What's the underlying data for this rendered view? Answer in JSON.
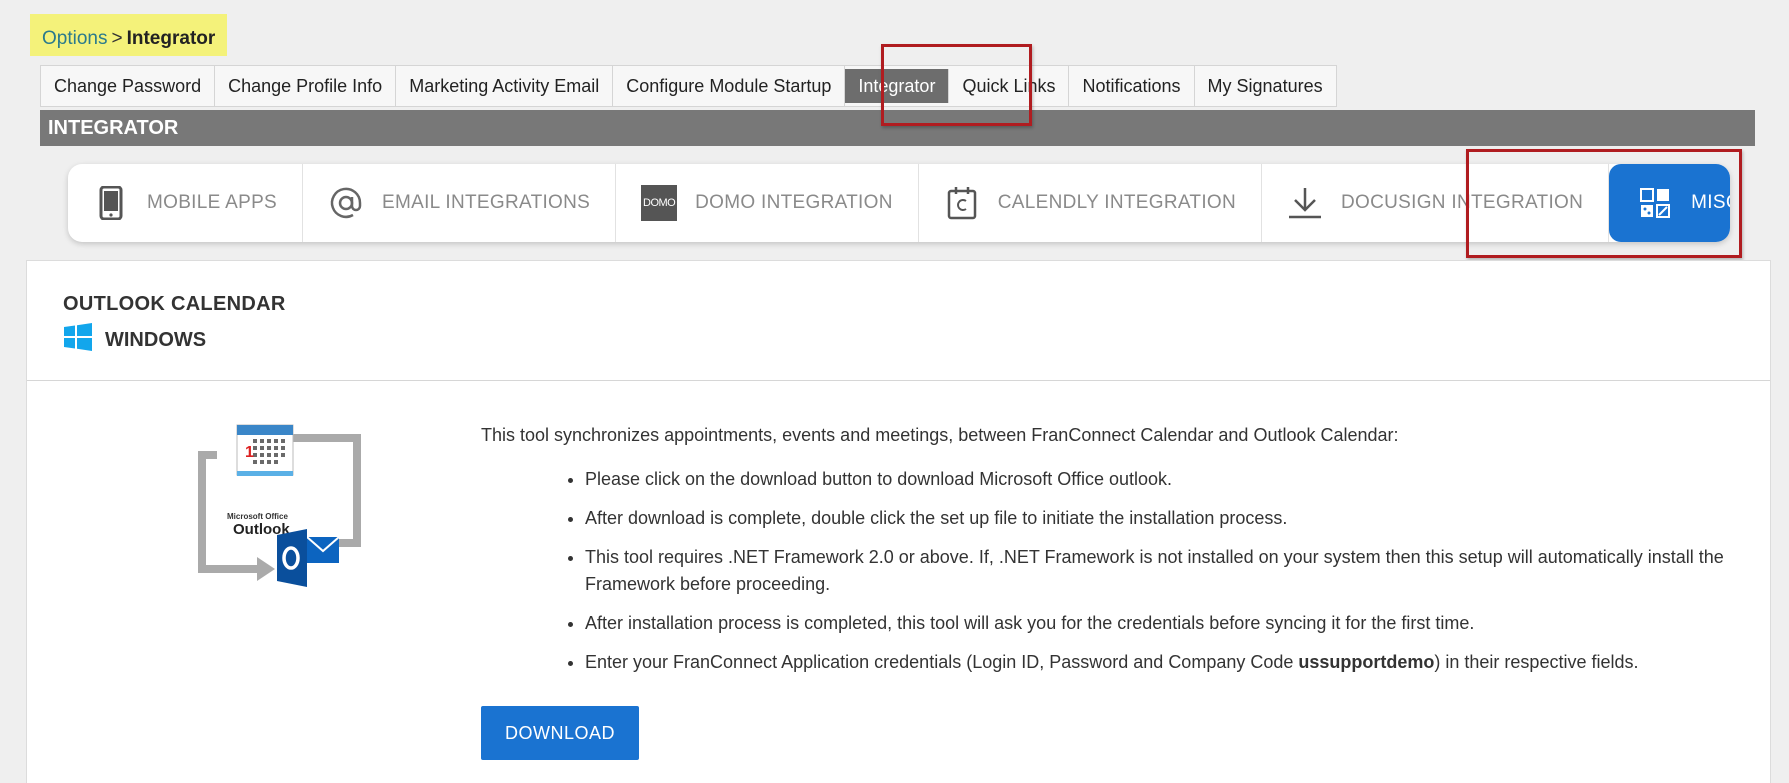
{
  "breadcrumb": {
    "parent": "Options",
    "separator": ">",
    "current": "Integrator"
  },
  "top_tabs": [
    {
      "label": "Change Password"
    },
    {
      "label": "Change Profile Info"
    },
    {
      "label": "Marketing Activity Email"
    },
    {
      "label": "Configure Module Startup"
    },
    {
      "label": "Integrator",
      "active": true
    },
    {
      "label": "Quick Links"
    },
    {
      "label": "Notifications"
    },
    {
      "label": "My Signatures"
    }
  ],
  "section_title": "INTEGRATOR",
  "sub_tabs": [
    {
      "label": "MOBILE APPS",
      "icon": "mobile-phone-icon"
    },
    {
      "label": "EMAIL INTEGRATIONS",
      "icon": "at-sign-icon"
    },
    {
      "label": "DOMO INTEGRATION",
      "icon": "domo-logo-icon",
      "icon_text": "DOMO"
    },
    {
      "label": "CALENDLY INTEGRATION",
      "icon": "calendly-icon"
    },
    {
      "label": "DOCUSIGN INTEGRATION",
      "icon": "download-arrow-icon"
    },
    {
      "label": "MISCELLANEOUS",
      "icon": "grid-icon",
      "active": true
    }
  ],
  "card": {
    "title": "OUTLOOK CALENDAR",
    "subtitle": "WINDOWS",
    "illustration_text": {
      "line1": "Microsoft Office",
      "line2": "Outlook",
      "calendar_day": "1"
    },
    "intro": "This tool synchronizes appointments, events and meetings, between FranConnect Calendar and Outlook Calendar:",
    "bullets": [
      "Please click on the download button to download Microsoft Office outlook.",
      "After download is complete, double click the set up file to initiate the installation process.",
      "This tool requires .NET Framework 2.0 or above. If, .NET Framework is not installed on your system then this setup will automatically install the Framework before proceeding.",
      "After installation process is completed, this tool will ask you for the credentials before syncing it for the first time."
    ],
    "last_bullet": {
      "before": "Enter your FranConnect Application credentials (Login ID, Password and Company Code ",
      "bold": "ussupportdemo",
      "after": ") in their respective fields."
    },
    "download_label": "DOWNLOAD"
  },
  "colors": {
    "accent": "#1a73d1",
    "section_bar": "#787878",
    "highlight": "#b01c20",
    "breadcrumb_bg": "#f4f27a"
  }
}
